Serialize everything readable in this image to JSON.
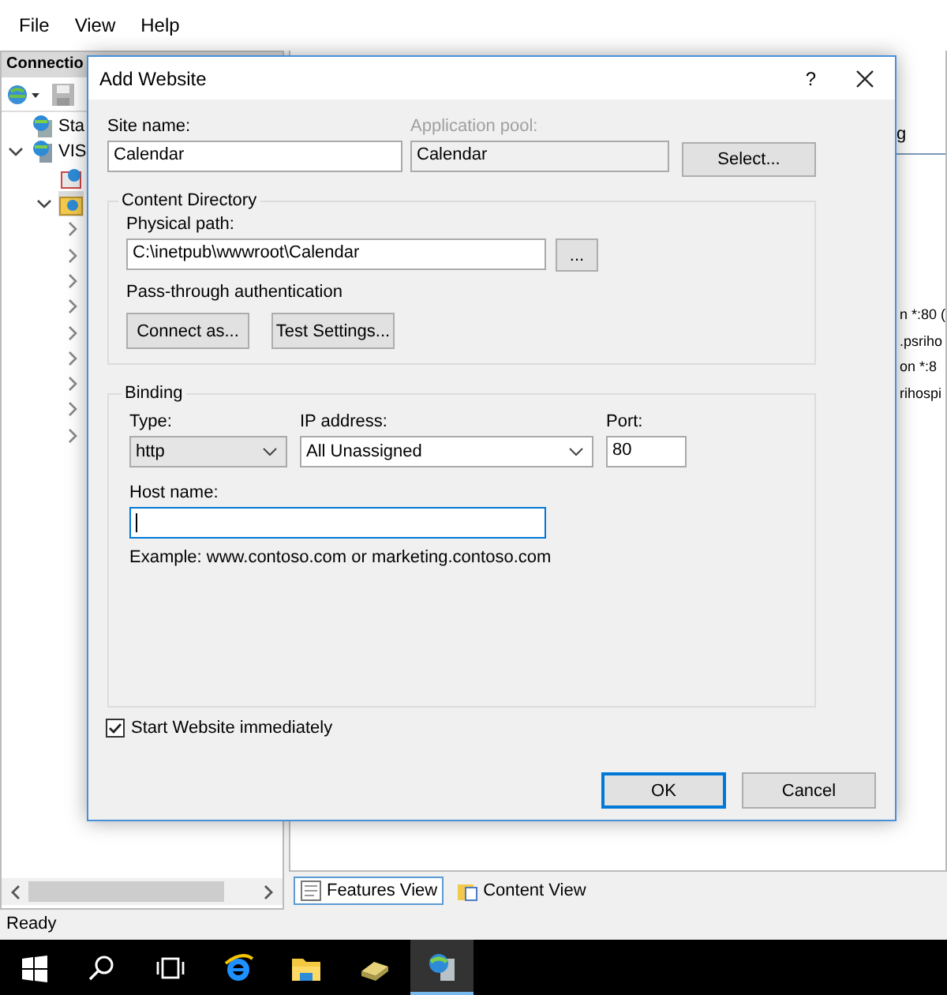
{
  "menu": [
    "File",
    "View",
    "Help"
  ],
  "connections": {
    "title": "Connectio",
    "tree": [
      {
        "label": "Sta",
        "kind": "start",
        "selected": false
      },
      {
        "label": "VIS",
        "kind": "server",
        "selected": false,
        "expanded": true,
        "children": [
          {
            "kind": "pools",
            "selected": false
          },
          {
            "kind": "sites",
            "selected": true,
            "expanded": true,
            "children": [
              {
                "selected": false,
                "expanded": false
              },
              {
                "selected": false,
                "expanded": false
              },
              {
                "selected": false,
                "expanded": false
              },
              {
                "selected": false,
                "expanded": false
              },
              {
                "selected": false,
                "expanded": false
              },
              {
                "selected": false,
                "expanded": false
              },
              {
                "selected": false,
                "expanded": false
              },
              {
                "selected": false,
                "expanded": false
              },
              {
                "selected": false,
                "expanded": false
              }
            ]
          }
        ]
      }
    ]
  },
  "actions_tab": "g",
  "content_lines": [
    "n *:80 (",
    ".psriho",
    "on *:8",
    "rihospi"
  ],
  "view_tabs": [
    {
      "label": "Features View",
      "selected": true
    },
    {
      "label": "Content View",
      "selected": false
    }
  ],
  "status_bar": "Ready",
  "taskbar": [
    {
      "kind": "start",
      "active": false
    },
    {
      "kind": "search",
      "active": false
    },
    {
      "kind": "taskview",
      "active": false
    },
    {
      "kind": "browser",
      "active": false
    },
    {
      "kind": "folder",
      "active": false
    },
    {
      "kind": "tool",
      "active": false
    },
    {
      "kind": "iis",
      "active": true
    }
  ],
  "dialog": {
    "title": "Add Website",
    "help": "?",
    "site_name": {
      "label": "Site name:",
      "value": "Calendar"
    },
    "app_pool": {
      "label": "Application pool:",
      "value": "Calendar",
      "disabled": true
    },
    "select_button": "Select...",
    "content_directory": {
      "title": "Content Directory",
      "physical_path": {
        "label": "Physical path:",
        "value": "C:\\inetpub\\wwwroot\\Calendar"
      },
      "browse_button": "...",
      "pass_through": "Pass-through authentication",
      "buttons": [
        "Connect as...",
        "Test Settings..."
      ]
    },
    "binding": {
      "title": "Binding",
      "type": {
        "label": "Type:",
        "value": "http",
        "editable": false
      },
      "ip": {
        "label": "IP address:",
        "value": "All Unassigned",
        "editable": true
      },
      "port": {
        "label": "Port:",
        "value": "80"
      },
      "host_name": {
        "label": "Host name:",
        "focused": true
      },
      "example": "Example: www.contoso.com or marketing.contoso.com"
    },
    "start_immediately": {
      "label": "Start Website immediately",
      "checked": true
    },
    "buttons": [
      {
        "label": "OK",
        "default": true
      },
      {
        "label": "Cancel",
        "default": false
      }
    ]
  }
}
